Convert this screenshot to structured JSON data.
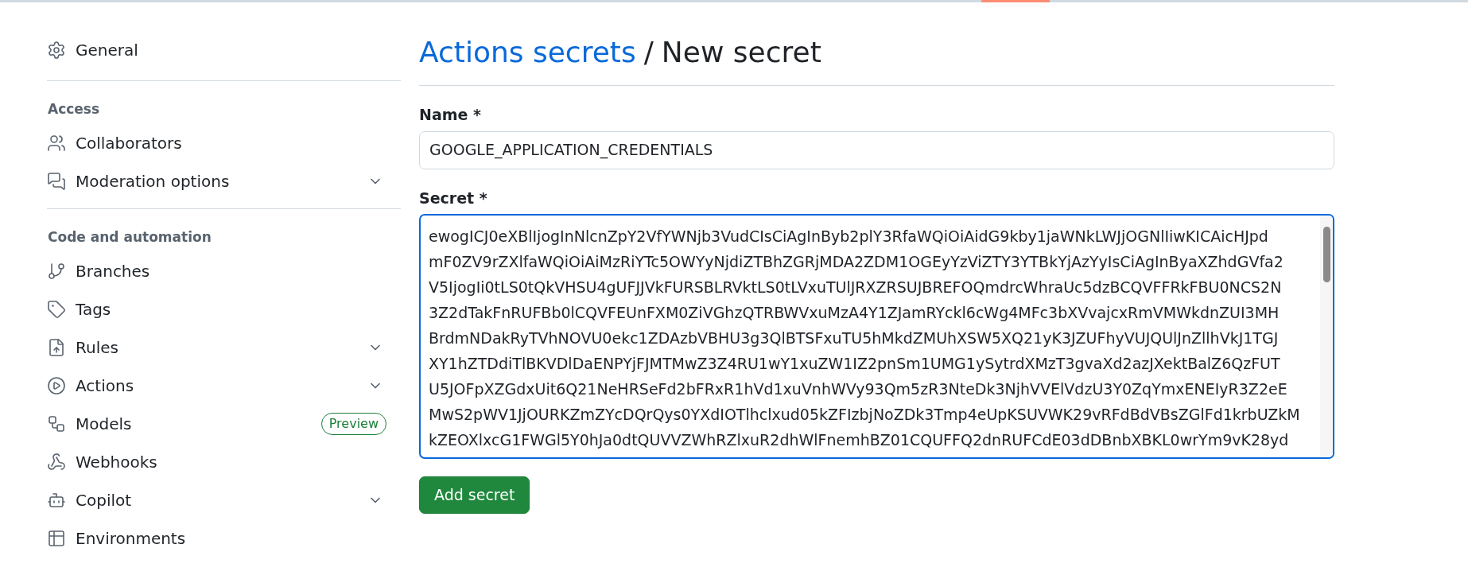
{
  "sidebar": {
    "sections": [
      {
        "items": [
          {
            "label": "General",
            "expandable": false
          }
        ]
      },
      {
        "heading": "Access",
        "items": [
          {
            "label": "Collaborators",
            "expandable": false
          },
          {
            "label": "Moderation options",
            "expandable": true
          }
        ]
      },
      {
        "heading": "Code and automation",
        "items": [
          {
            "label": "Branches",
            "expandable": false
          },
          {
            "label": "Tags",
            "expandable": false
          },
          {
            "label": "Rules",
            "expandable": true
          },
          {
            "label": "Actions",
            "expandable": true
          },
          {
            "label": "Models",
            "expandable": false,
            "badge": "Preview"
          },
          {
            "label": "Webhooks",
            "expandable": false
          },
          {
            "label": "Copilot",
            "expandable": true
          },
          {
            "label": "Environments",
            "expandable": false
          }
        ]
      }
    ]
  },
  "header": {
    "link": "Actions secrets",
    "separator": "/",
    "title": "New secret"
  },
  "form": {
    "name_label": "Name *",
    "name_value": "GOOGLE_APPLICATION_CREDENTIALS",
    "secret_label": "Secret *",
    "secret_lines": [
      "ewogICJ0eXBlIjogInNlcnZpY2VfYWNjb3VudCIsCiAgInByb2plY3RfaWQiOiAidG9kby1jaWNkLWJjOGNlIiwKICAicHJpd",
      "mF0ZV9rZXlfaWQiOiAiMzRiYTc5OWYyNjdiZTBhZGRjMDA2ZDM1OGEyYzViZTY3YTBkYjAzYyIsCiAgInByaXZhdGVfa2",
      "V5IjogIi0tLS0tQkVHSU4gUFJJVkFURSBLRVktLS0tLVxuTUlJRXZRSUJBREFOQmdrcWhraUc5dzBCQVFFRkFBU0NCS2N",
      "3Z2dTakFnRUFBb0lCQVFEUnFXM0ZiVGhzQTRBWVxuMzA4Y1ZJamRYckl6cWg4MFc3bXVvajcxRmVMWkdnZUI3MH",
      "BrdmNDakRyTVhNOVU0ekc1ZDAzbVBHU3g3QlBTSFxuTU5hMkdZMUhXSW5XQ21yK3JZUFhyVUJQUlJnZllhVkJ1TGJ",
      "XY1hZTDdiTlBKVDlDaENPYjFJMTMwZ3Z4RU1wY1xuZW1IZ2pnSm1UMG1ySytrdXMzT3gvaXd2azJXektBalZ6QzFUT",
      "U5JOFpXZGdxUit6Q21NeHRSeFd2bFRxR1hVd1xuVnhWVy93Qm5zR3NteDk3NjhVVElVdzU3Y0ZqYmxENEIyR3Z2eE",
      "MwS2pWV1JjOURKZmZYcDQrQys0YXdIOTlhclxud05kZFIzbjNoZDk3Tmp4eUpKSUVWK29vRFdBdVBsZGlFd1krbUZkM",
      "kZEOXlxcG1FWGl5Y0hJa0dtQUVVZWhRZlxuR2dhWlFnemhBZ01CQUFFQ2dnRUFCdE03dDBnbXBKL0wrYm9vK28yd"
    ],
    "submit": "Add secret"
  }
}
